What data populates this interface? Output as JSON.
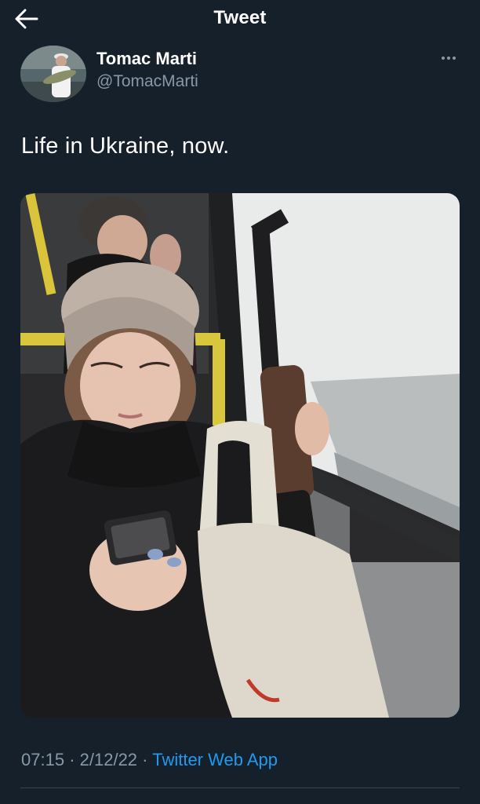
{
  "header": {
    "title": "Tweet",
    "back_icon": "arrow-left-icon"
  },
  "author": {
    "display_name": "Tomac Marti",
    "handle": "@TomacMarti",
    "more_icon": "more-horizontal-icon"
  },
  "tweet": {
    "text": "Life in Ukraine, now."
  },
  "meta": {
    "time": "07:15",
    "date": "2/12/22",
    "source": "Twitter Web App",
    "separator": "·"
  },
  "colors": {
    "background": "#15202b",
    "secondary_text": "#8899a6",
    "link": "#1d9bf0",
    "divider": "#38444d"
  }
}
